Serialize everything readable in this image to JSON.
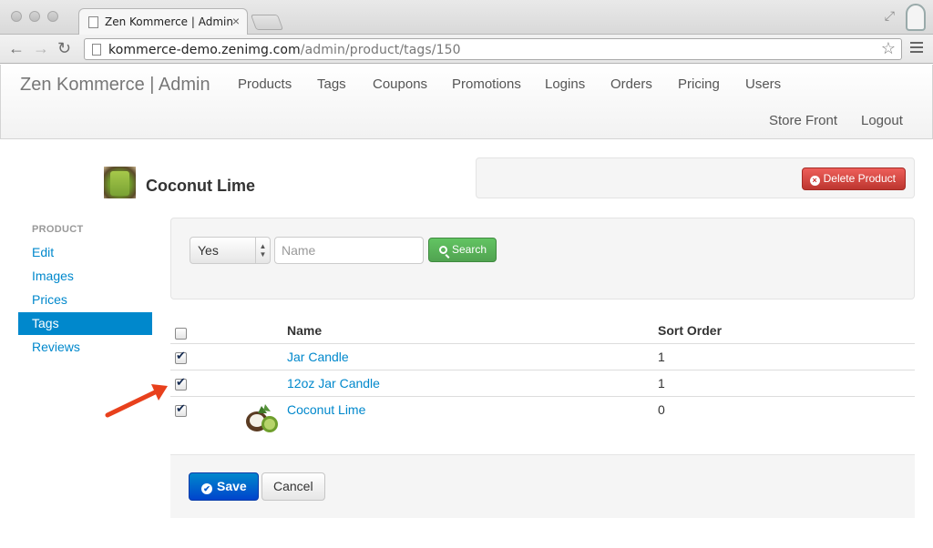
{
  "browser": {
    "tab_title": "Zen Kommerce | Admin",
    "url_host": "kommerce-demo.zenimg.com",
    "url_path": "/admin/product/tags/150"
  },
  "navbar": {
    "brand": "Zen Kommerce | Admin",
    "links": [
      "Products",
      "Tags",
      "Coupons",
      "Promotions",
      "Logins",
      "Orders",
      "Pricing",
      "Users"
    ],
    "right_links": [
      "Store Front",
      "Logout"
    ]
  },
  "product": {
    "title": "Coconut Lime",
    "delete_label": "Delete Product"
  },
  "sidebar": {
    "header": "PRODUCT",
    "items": [
      {
        "label": "Edit",
        "active": false
      },
      {
        "label": "Images",
        "active": false
      },
      {
        "label": "Prices",
        "active": false
      },
      {
        "label": "Tags",
        "active": true
      },
      {
        "label": "Reviews",
        "active": false
      }
    ]
  },
  "filter": {
    "select_value": "Yes",
    "name_placeholder": "Name",
    "name_value": "",
    "search_label": "Search"
  },
  "table": {
    "headers": {
      "name": "Name",
      "sort_order": "Sort Order"
    },
    "rows": [
      {
        "name": "Jar Candle",
        "sort_order": "1",
        "checked": true
      },
      {
        "name": "12oz Jar Candle",
        "sort_order": "1",
        "checked": true
      },
      {
        "name": "Coconut Lime",
        "sort_order": "0",
        "checked": true
      }
    ]
  },
  "actions": {
    "save_label": "Save",
    "cancel_label": "Cancel"
  },
  "colors": {
    "primary": "#0088cc",
    "danger": "#da4f49",
    "success": "#5bb75b",
    "annotation_arrow": "#e8401c"
  }
}
